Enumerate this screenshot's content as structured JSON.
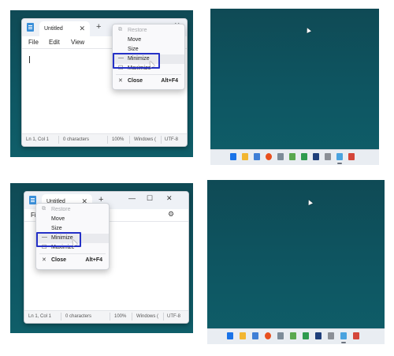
{
  "notepad": {
    "tab_title": "Untitled",
    "tab_close": "✕",
    "new_tab": "+",
    "menu": [
      "File",
      "Edit",
      "View"
    ],
    "minimize_glyph": "—",
    "maximize_glyph": "☐",
    "close_glyph": "✕",
    "settings_glyph": "⚙",
    "status": {
      "position": "Ln 1, Col 1",
      "characters": "0 characters",
      "zoom": "100%",
      "line_ending": "Windows (",
      "encoding": "UTF-8"
    }
  },
  "context_menu": {
    "items": [
      {
        "icon": "restore-icon",
        "glyph": "⧉",
        "label": "Restore",
        "disabled": true
      },
      {
        "icon": "",
        "glyph": "",
        "label": "Move"
      },
      {
        "icon": "",
        "glyph": "",
        "label": "Size"
      },
      {
        "icon": "minimize-icon",
        "glyph": "—",
        "label": "Minimize",
        "highlighted": true
      },
      {
        "icon": "maximize-icon",
        "glyph": "☐",
        "label": "Maximize"
      },
      {
        "icon": "close-icon",
        "glyph": "✕",
        "label": "Close",
        "shortcut": "Alt+F4",
        "bold": true
      }
    ]
  },
  "taskbar": {
    "icons": [
      "windows-start-icon",
      "file-explorer-icon",
      "photos-icon",
      "firefox-icon",
      "document-icon",
      "notepad-icon",
      "spreadsheet-icon",
      "l-app-icon",
      "arrow-app-icon",
      "notepad-taskbar-icon",
      "pinned-app-icon"
    ],
    "colors": [
      "#1a73e8",
      "#f2b632",
      "#3f7fd6",
      "#e8501f",
      "#7d8c99",
      "#5aa84f",
      "#2f9b4f",
      "#1f3f7a",
      "#8b8f96",
      "#4aa3df",
      "#d4463a"
    ]
  },
  "colors": {
    "desktop": "#0f5561",
    "highlight_box": "#2531c7",
    "window_bg": "#ffffff"
  }
}
